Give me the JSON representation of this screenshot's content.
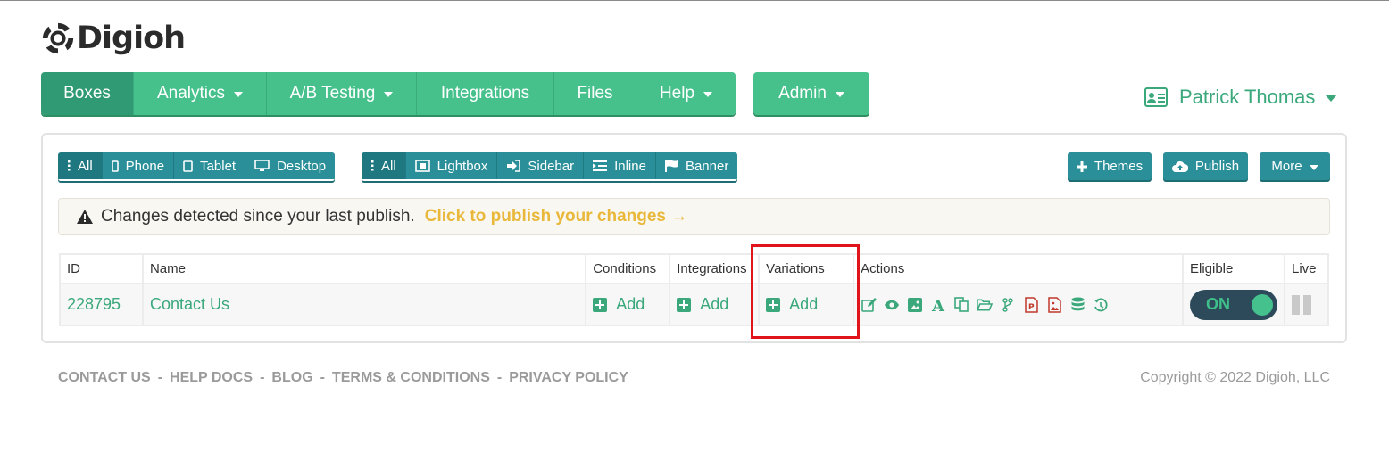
{
  "brand": {
    "name": "Digioh",
    "logo_icon": "digioh-logo-icon"
  },
  "nav": {
    "items": [
      {
        "label": "Boxes",
        "dropdown": false,
        "active": true
      },
      {
        "label": "Analytics",
        "dropdown": true,
        "active": false
      },
      {
        "label": "A/B Testing",
        "dropdown": true,
        "active": false
      },
      {
        "label": "Integrations",
        "dropdown": false,
        "active": false
      },
      {
        "label": "Files",
        "dropdown": false,
        "active": false
      },
      {
        "label": "Help",
        "dropdown": true,
        "active": false
      }
    ],
    "admin_label": "Admin"
  },
  "user": {
    "name": "Patrick Thomas",
    "icon": "id-card-icon"
  },
  "device_filter": [
    {
      "label": "All",
      "icon": "more-vertical-icon",
      "selected": true
    },
    {
      "label": "Phone",
      "icon": "phone-icon",
      "selected": false
    },
    {
      "label": "Tablet",
      "icon": "tablet-icon",
      "selected": false
    },
    {
      "label": "Desktop",
      "icon": "desktop-icon",
      "selected": false
    }
  ],
  "type_filter": [
    {
      "label": "All",
      "icon": "more-vertical-icon",
      "selected": true
    },
    {
      "label": "Lightbox",
      "icon": "lightbox-icon",
      "selected": false
    },
    {
      "label": "Sidebar",
      "icon": "sign-in-icon",
      "selected": false
    },
    {
      "label": "Inline",
      "icon": "inline-icon",
      "selected": false
    },
    {
      "label": "Banner",
      "icon": "flag-icon",
      "selected": false
    }
  ],
  "toolbar": {
    "themes_label": "Themes",
    "publish_label": "Publish",
    "more_label": "More"
  },
  "alert": {
    "message": "Changes detected since your last publish.",
    "link": "Click to publish your changes →"
  },
  "table": {
    "headers": [
      "ID",
      "Name",
      "Conditions",
      "Integrations",
      "Variations",
      "Actions",
      "Eligible",
      "Live"
    ],
    "rows": [
      {
        "id": "228795",
        "name": "Contact Us",
        "conditions": "Add",
        "integrations": "Add",
        "variations": "Add",
        "eligible": "ON"
      }
    ],
    "action_icons": [
      "edit-icon",
      "eye-icon",
      "image-icon",
      "font-icon",
      "copy-icon",
      "folder-open-icon",
      "code-fork-icon",
      "pdf-file-icon",
      "image-file-icon",
      "database-icon",
      "history-icon"
    ]
  },
  "footer": {
    "links": [
      "CONTACT US",
      "HELP DOCS",
      "BLOG",
      "TERMS & CONDITIONS",
      "PRIVACY POLICY"
    ],
    "separator": "-",
    "copyright": "Copyright © 2022 Digioh, LLC"
  },
  "colors": {
    "primary_green": "#46c18c",
    "teal": "#2a8f98",
    "highlight_red": "#e0141a",
    "link_yellow": "#e9b83a"
  }
}
